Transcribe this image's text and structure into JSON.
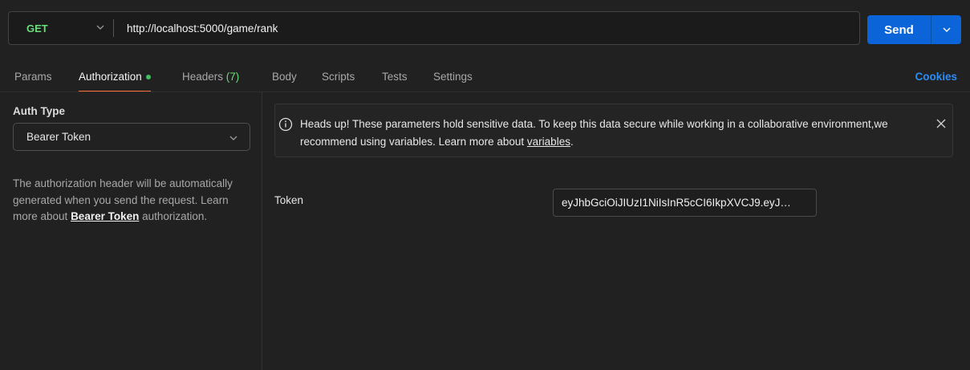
{
  "request": {
    "method": "GET",
    "url": "http://localhost:5000/game/rank",
    "send_label": "Send"
  },
  "tabs": [
    {
      "label": "Params"
    },
    {
      "label": "Authorization"
    },
    {
      "label": "Headers",
      "count": "(7)"
    },
    {
      "label": "Body"
    },
    {
      "label": "Scripts"
    },
    {
      "label": "Tests"
    },
    {
      "label": "Settings"
    }
  ],
  "cookies_label": "Cookies",
  "auth": {
    "type_label": "Auth Type",
    "type_value": "Bearer Token",
    "desc_text": "The authorization header will be automatically generated when you send the request. Learn more about",
    "desc_link": "Bearer Token",
    "desc_tail": "authorization."
  },
  "banner": {
    "text": "Heads up! These parameters hold sensitive data. To keep this data secure while working in a collaborative environment,we recommend using variables. Learn more about",
    "link": "variables",
    "tail": "."
  },
  "token": {
    "label": "Token",
    "value": "eyJhbGciOiJIUzI1NiIsInR5cCI6IkpXVCJ9.eyJ…"
  },
  "colors": {
    "accent_blue": "#0b65d9",
    "method_green": "#6bdd7a",
    "active_tab_underline": "#ff6c37",
    "cookies_blue": "#2a8cf5"
  }
}
